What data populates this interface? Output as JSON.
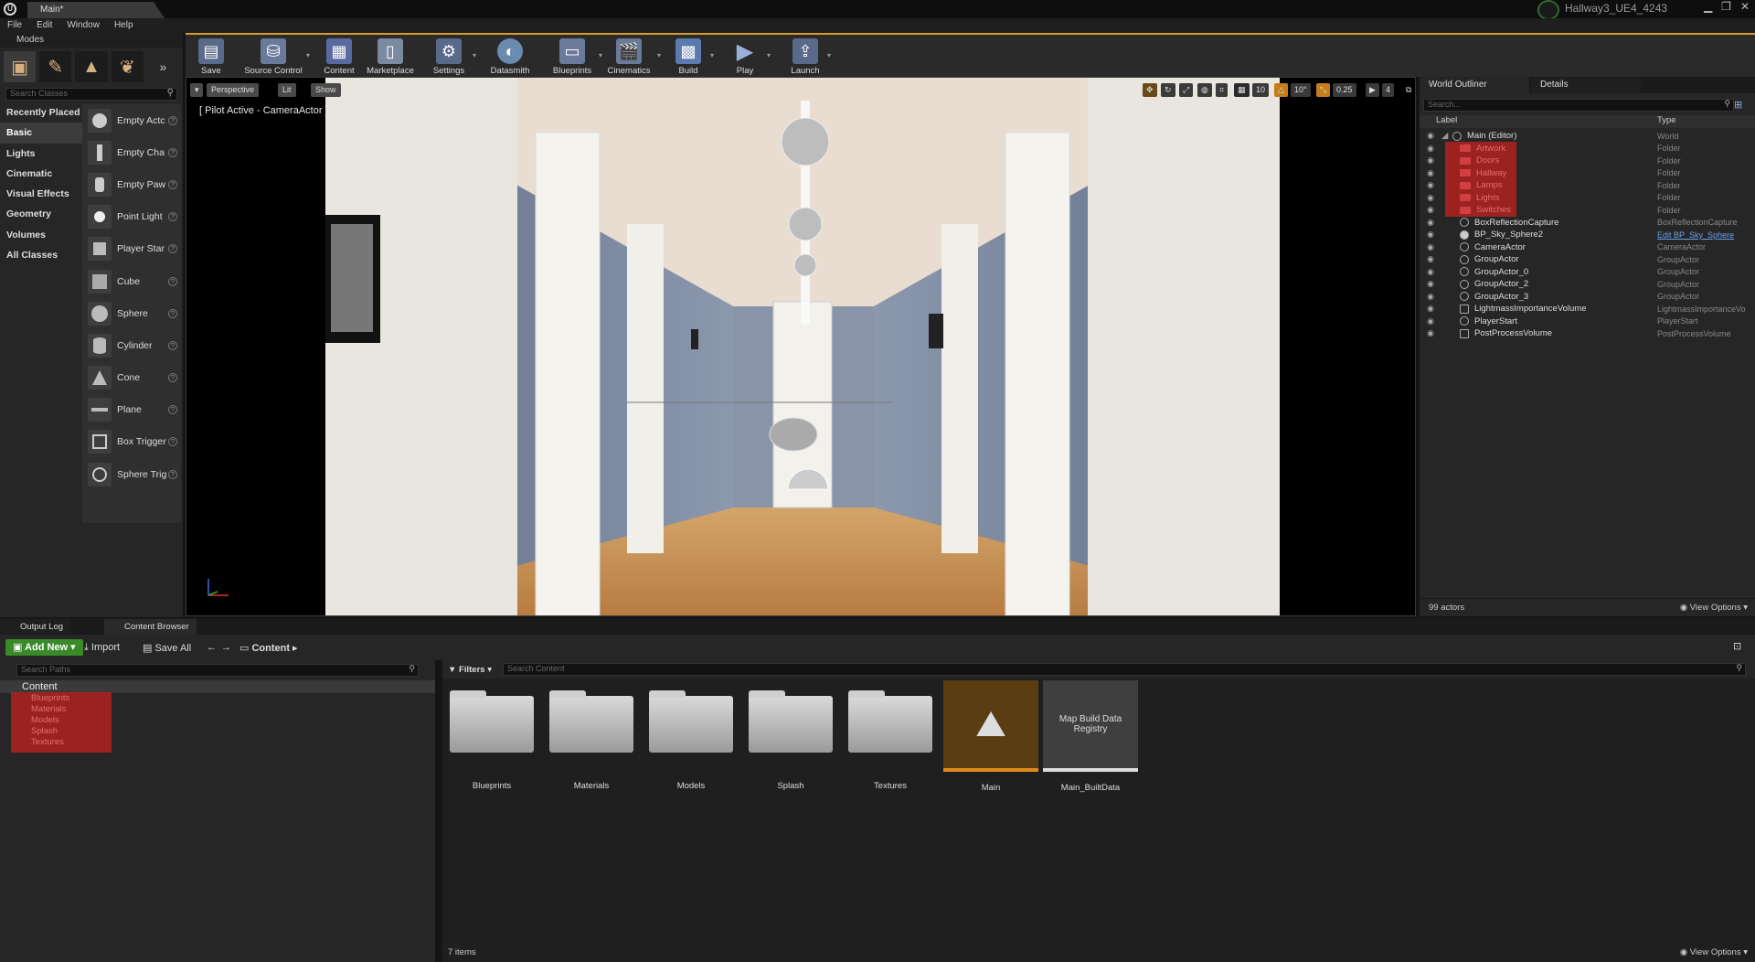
{
  "titlebar": {
    "tab_label": "Main*",
    "project_name": "Hallway3_UE4_4243",
    "window_buttons": [
      "▁",
      "❐",
      "✕"
    ]
  },
  "menubar": {
    "items": [
      "File",
      "Edit",
      "Window",
      "Help"
    ]
  },
  "modes": {
    "header": "Modes",
    "search_placeholder": "Search Classes",
    "categories": [
      "Recently Placed",
      "Basic",
      "Lights",
      "Cinematic",
      "Visual Effects",
      "Geometry",
      "Volumes",
      "All Classes"
    ],
    "active_category": "Basic",
    "items": [
      "Empty Actc",
      "Empty Cha",
      "Empty Paw",
      "Point Light",
      "Player Star",
      "Cube",
      "Sphere",
      "Cylinder",
      "Cone",
      "Plane",
      "Box Trigger",
      "Sphere Trig"
    ]
  },
  "toolbar": {
    "buttons": [
      "Save Current",
      "Source Control",
      "Content",
      "Marketplace",
      "Settings",
      "Datasmith",
      "Blueprints",
      "Cinematics",
      "Build",
      "Play",
      "Launch"
    ],
    "accent": "#d79b28"
  },
  "viewport": {
    "perspective": "Perspective",
    "lit": "Lit",
    "show": "Show",
    "pilot": "[ Pilot Active - CameraActor ]",
    "grid_snap": "10",
    "rot_snap": "10°",
    "scale_snap": "0.25",
    "cam_speed": "4"
  },
  "outliner": {
    "tabs": [
      "World Outliner",
      "Details"
    ],
    "search_placeholder": "Search...",
    "col_label": "Label",
    "col_type": "Type",
    "rows": [
      {
        "label": "Main (Editor)",
        "type": "World",
        "kind": "world"
      },
      {
        "label": "Artwork",
        "type": "Folder",
        "kind": "folder"
      },
      {
        "label": "Doors",
        "type": "Folder",
        "kind": "folder"
      },
      {
        "label": "Hallway",
        "type": "Folder",
        "kind": "folder"
      },
      {
        "label": "Lamps",
        "type": "Folder",
        "kind": "folder"
      },
      {
        "label": "Lights",
        "type": "Folder",
        "kind": "folder"
      },
      {
        "label": "Switches",
        "type": "Folder",
        "kind": "folder"
      },
      {
        "label": "BoxReflectionCapture",
        "type": "BoxReflectionCapture",
        "kind": "actor"
      },
      {
        "label": "BP_Sky_Sphere2",
        "type": "Edit BP_Sky_Sphere",
        "kind": "actor"
      },
      {
        "label": "CameraActor",
        "type": "CameraActor",
        "kind": "actor"
      },
      {
        "label": "GroupActor",
        "type": "GroupActor",
        "kind": "actor"
      },
      {
        "label": "GroupActor_0",
        "type": "GroupActor",
        "kind": "actor"
      },
      {
        "label": "GroupActor_2",
        "type": "GroupActor",
        "kind": "actor"
      },
      {
        "label": "GroupActor_3",
        "type": "GroupActor",
        "kind": "actor"
      },
      {
        "label": "LightmassImportanceVolume",
        "type": "LightmassImportanceVo",
        "kind": "actor"
      },
      {
        "label": "PlayerStart",
        "type": "PlayerStart",
        "kind": "actor"
      },
      {
        "label": "PostProcessVolume",
        "type": "PostProcessVolume",
        "kind": "actor"
      }
    ],
    "actor_count": "99 actors",
    "view_options": "View Options"
  },
  "bottom_tabs": [
    "Output Log",
    "Content Browser"
  ],
  "content_browser": {
    "add_new": "Add New",
    "import": "Import",
    "save_all": "Save All",
    "path": "Content",
    "paths_search_placeholder": "Search Paths",
    "root_folder": "Content",
    "subfolders": [
      "Blueprints",
      "Materials",
      "Models",
      "Splash",
      "Textures"
    ],
    "filters": "Filters",
    "search_placeholder": "Search Content",
    "assets": [
      {
        "name": "Blueprints",
        "kind": "folder"
      },
      {
        "name": "Materials",
        "kind": "folder"
      },
      {
        "name": "Models",
        "kind": "folder"
      },
      {
        "name": "Splash",
        "kind": "folder"
      },
      {
        "name": "Textures",
        "kind": "folder"
      },
      {
        "name": "Main",
        "kind": "level"
      },
      {
        "name": "Main_BuiltData",
        "kind": "builddata",
        "thumb_text": "Map Build Data Registry"
      }
    ],
    "item_count": "7 items",
    "view_options": "View Options"
  }
}
